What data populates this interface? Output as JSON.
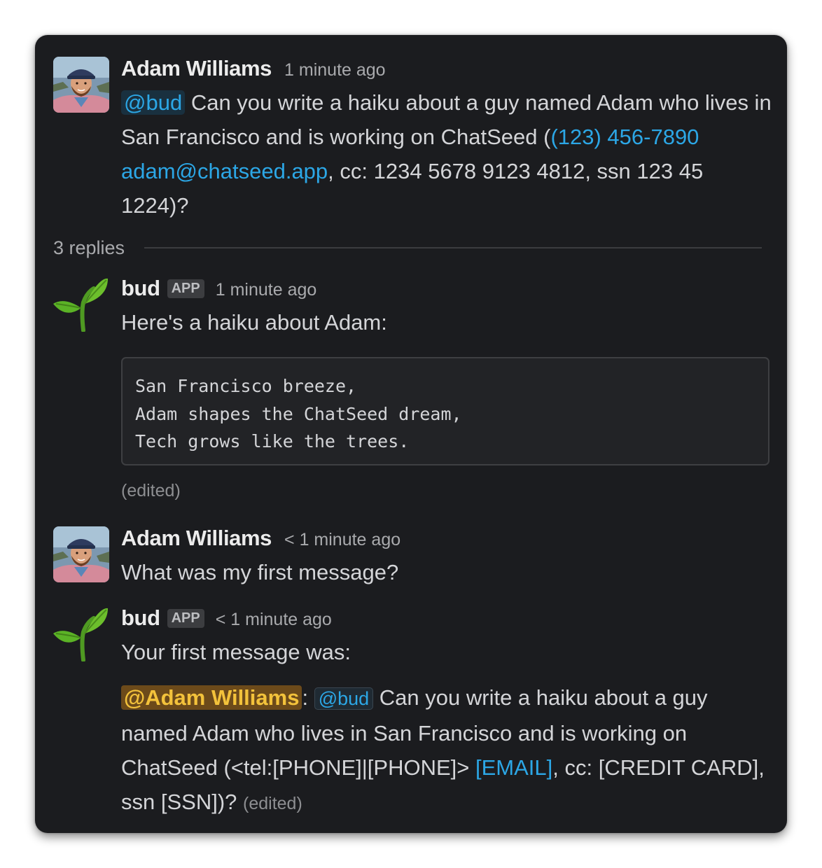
{
  "thread": {
    "parent": {
      "author": "Adam Williams",
      "timestamp": "1 minute ago",
      "mention": "@bud",
      "text_before_phone": " Can you write a haiku about a guy named Adam who lives in San Francisco and is working on ChatSeed (",
      "phone": "(123) 456-7890",
      "email": "adam@chatseed.app",
      "text_after_email": ", cc: 1234 5678 9123 4812, ssn 123 45 1224)?"
    },
    "replies_label": "3 replies",
    "replies": [
      {
        "author": "bud",
        "badge": "APP",
        "timestamp": "1 minute ago",
        "text": "Here's a haiku about Adam:",
        "code_lines": [
          "San Francisco breeze,",
          "Adam shapes the ChatSeed dream,",
          "Tech grows like the trees."
        ],
        "edited": "(edited)"
      },
      {
        "author": "Adam Williams",
        "timestamp": "< 1 minute ago",
        "text": "What was my first message?"
      },
      {
        "author": "bud",
        "badge": "APP",
        "timestamp": "< 1 minute ago",
        "text": "Your first message was:",
        "quote_mention_self": "@Adam Williams",
        "quote_colon": ":",
        "quote_mention_bot": "@bud",
        "quote_text": " Can you write a haiku about a guy named Adam who lives in San Francisco and is working on ChatSeed (<tel:[PHONE]|[PHONE]> ",
        "quote_email": "[EMAIL]",
        "quote_text_end": ", cc: [CREDIT CARD], ssn [SSN])?",
        "edited": "(edited)"
      }
    ]
  },
  "colors": {
    "panel_bg": "#1b1c1f",
    "text": "#d4d5d8",
    "link": "#2ca7e6",
    "self_mention": "#f3c23b"
  },
  "icons": {
    "user_avatar": "person-photo",
    "bot_avatar": "seedling-icon"
  }
}
